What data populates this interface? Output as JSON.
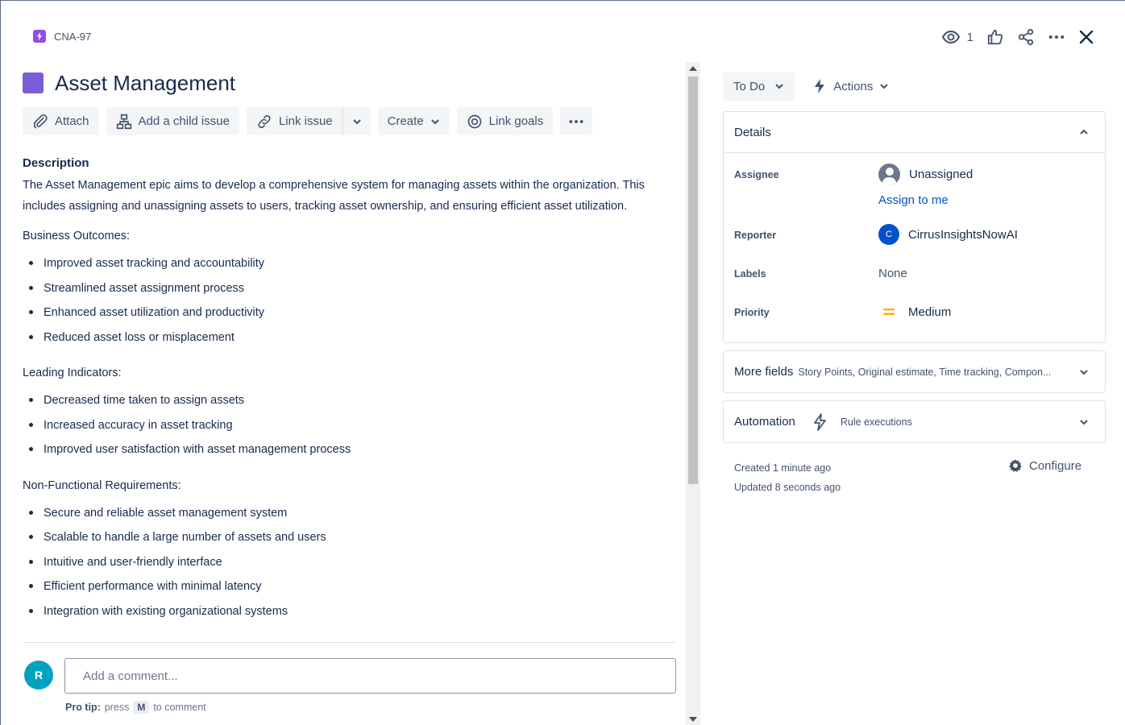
{
  "header": {
    "issue_key": "CNA-97",
    "watch_count": "1",
    "icons": [
      "eye-icon",
      "thumbs-up-icon",
      "share-icon",
      "more-icon",
      "close-icon"
    ]
  },
  "issue": {
    "title": "Asset Management",
    "epic_color": "#7b5dd6"
  },
  "toolbar": {
    "attach": "Attach",
    "add_child": "Add a child issue",
    "link_issue": "Link issue",
    "create": "Create",
    "link_goals": "Link goals"
  },
  "description": {
    "label": "Description",
    "text": "The Asset Management epic aims to develop a comprehensive system for managing assets within the organization. This includes assigning and unassigning assets to users, tracking asset ownership, and ensuring efficient asset utilization.",
    "business_heading": "Business Outcomes:",
    "business_items": [
      "Improved asset tracking and accountability",
      "Streamlined asset assignment process",
      "Enhanced asset utilization and productivity",
      "Reduced asset loss or misplacement"
    ],
    "leading_heading": "Leading Indicators:",
    "leading_items": [
      "Decreased time taken to assign assets",
      "Increased accuracy in asset tracking",
      "Improved user satisfaction with asset management process"
    ],
    "nfr_heading": "Non-Functional Requirements:",
    "nfr_items": [
      "Secure and reliable asset management system",
      "Scalable to handle a large number of assets and users",
      "Intuitive and user-friendly interface",
      "Efficient performance with minimal latency",
      "Integration with existing organizational systems"
    ]
  },
  "comment": {
    "avatar_initial": "R",
    "placeholder": "Add a comment...",
    "protip_label": "Pro tip:",
    "protip_press": "press",
    "protip_key": "M",
    "protip_suffix": "to comment"
  },
  "status": {
    "current": "To Do",
    "actions": "Actions"
  },
  "details": {
    "heading": "Details",
    "assignee_label": "Assignee",
    "assignee_value": "Unassigned",
    "assign_to_me": "Assign to me",
    "reporter_label": "Reporter",
    "reporter_initial": "C",
    "reporter_value": "CirrusInsightsNowAI",
    "labels_label": "Labels",
    "labels_value": "None",
    "priority_label": "Priority",
    "priority_value": "Medium",
    "priority_color": "#ffab00"
  },
  "more_fields": {
    "label": "More fields",
    "summary": "Story Points, Original estimate, Time tracking, Compon..."
  },
  "automation": {
    "label": "Automation",
    "sub": "Rule executions"
  },
  "meta": {
    "created": "Created 1 minute ago",
    "updated": "Updated 8 seconds ago",
    "configure": "Configure"
  }
}
